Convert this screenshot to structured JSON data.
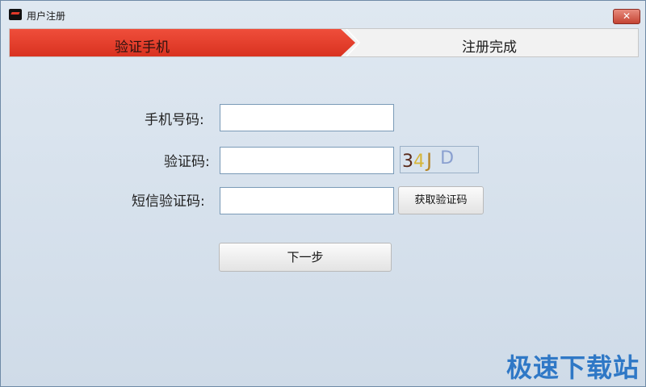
{
  "window": {
    "title": "用户注册",
    "close_label": "✕"
  },
  "steps": {
    "step1": "验证手机",
    "step2": "注册完成"
  },
  "form": {
    "phone_label": "手机号码:",
    "phone_value": "",
    "captcha_label": "验证码:",
    "captcha_value": "",
    "captcha_chars": [
      "3",
      "4",
      "J",
      "D"
    ],
    "sms_label": "短信验证码:",
    "sms_value": "",
    "get_code_button": "获取验证码",
    "next_button": "下一步"
  },
  "colors": {
    "active_step": "#e63b28",
    "captcha_colors": [
      "#5a2a1a",
      "#d6b63a",
      "#b5862a",
      "#8aa0d0"
    ]
  },
  "watermark": "极速下载站"
}
